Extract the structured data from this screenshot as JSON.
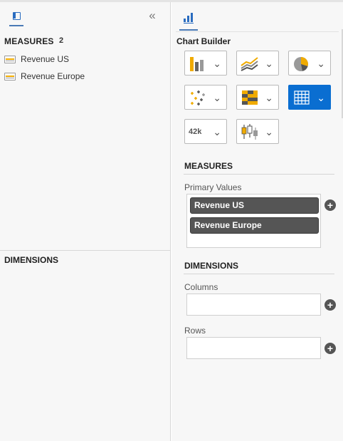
{
  "left_panel": {
    "measures_heading": "MEASURES",
    "measures_count": "2",
    "measures": [
      {
        "label": "Revenue US"
      },
      {
        "label": "Revenue Europe"
      }
    ],
    "dimensions_heading": "DIMENSIONS",
    "collapse_glyph": "«"
  },
  "chart_builder": {
    "title": "Chart Builder",
    "chart_types": [
      {
        "icon": "bar-chart-icon",
        "selected": false
      },
      {
        "icon": "line-chart-icon",
        "selected": false
      },
      {
        "icon": "pie-chart-icon",
        "selected": false
      },
      {
        "icon": "scatter-chart-icon",
        "selected": false
      },
      {
        "icon": "heatmap-icon",
        "selected": false
      },
      {
        "icon": "table-icon",
        "selected": true
      },
      {
        "icon": "numeric-point-icon",
        "text": "42k",
        "selected": false
      },
      {
        "icon": "box-plot-icon",
        "selected": false
      }
    ],
    "measures_section": "MEASURES",
    "primary_values_label": "Primary Values",
    "primary_values": [
      "Revenue US",
      "Revenue Europe"
    ],
    "dimensions_section": "DIMENSIONS",
    "columns_label": "Columns",
    "rows_label": "Rows",
    "add_glyph": "+",
    "chevron_glyph": "⌄"
  },
  "colors": {
    "accent_blue": "#0a6ed1",
    "icon_yellow": "#f0ab00",
    "pill_gray": "#555555",
    "panel_bg": "#f7f7f7"
  }
}
